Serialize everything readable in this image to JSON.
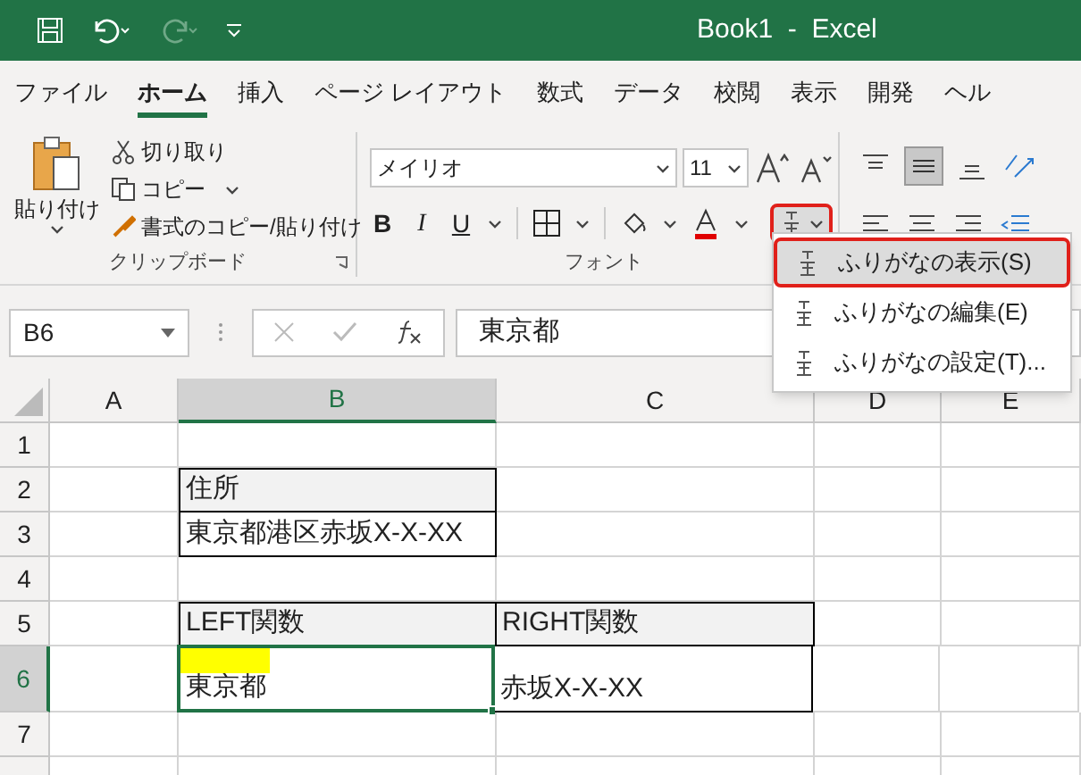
{
  "title_bar": {
    "title": "Book1  -  Excel"
  },
  "menu_tabs": [
    {
      "label": "ファイル",
      "selected": false
    },
    {
      "label": "ホーム",
      "selected": true
    },
    {
      "label": "挿入",
      "selected": false
    },
    {
      "label": "ページ レイアウト",
      "selected": false
    },
    {
      "label": "数式",
      "selected": false
    },
    {
      "label": "データ",
      "selected": false
    },
    {
      "label": "校閲",
      "selected": false
    },
    {
      "label": "表示",
      "selected": false
    },
    {
      "label": "開発",
      "selected": false
    },
    {
      "label": "ヘル",
      "selected": false
    }
  ],
  "clipboard": {
    "paste": "貼り付け",
    "cut": "切り取り",
    "copy": "コピー",
    "format_painter": "書式のコピー/貼り付け",
    "label": "クリップボード"
  },
  "font": {
    "name": "メイリオ",
    "size": "11",
    "bold": "B",
    "italic": "I",
    "underline": "U",
    "label": "フォント"
  },
  "furigana_menu": {
    "items": [
      {
        "label": "ふりがなの表示(S)",
        "selected": true
      },
      {
        "label": "ふりがなの編集(E)",
        "selected": false
      },
      {
        "label": "ふりがなの設定(T)...",
        "selected": false
      }
    ]
  },
  "formula_bar": {
    "name_box": "B6",
    "value": "東京都"
  },
  "columns": [
    {
      "label": "A",
      "selected": false
    },
    {
      "label": "B",
      "selected": true
    },
    {
      "label": "C",
      "selected": false
    },
    {
      "label": "D",
      "selected": false
    },
    {
      "label": "E",
      "selected": false
    }
  ],
  "rows": [
    {
      "number": "1",
      "selected": false,
      "cells": [
        {
          "kind": "plain"
        },
        {
          "kind": "plain"
        },
        {
          "kind": "plain"
        },
        {
          "kind": "plain"
        },
        {
          "kind": "plain"
        }
      ]
    },
    {
      "number": "2",
      "selected": false,
      "cells": [
        {
          "kind": "plain"
        },
        {
          "kind": "header",
          "text": "住所"
        },
        {
          "kind": "plain"
        },
        {
          "kind": "plain"
        },
        {
          "kind": "plain"
        }
      ]
    },
    {
      "number": "3",
      "selected": false,
      "cells": [
        {
          "kind": "plain"
        },
        {
          "kind": "value",
          "text": "東京都港区赤坂X-X-XX"
        },
        {
          "kind": "plain"
        },
        {
          "kind": "plain"
        },
        {
          "kind": "plain"
        }
      ]
    },
    {
      "number": "4",
      "selected": false,
      "cells": [
        {
          "kind": "plain"
        },
        {
          "kind": "plain"
        },
        {
          "kind": "plain"
        },
        {
          "kind": "plain"
        },
        {
          "kind": "plain"
        }
      ]
    },
    {
      "number": "5",
      "selected": false,
      "cells": [
        {
          "kind": "plain"
        },
        {
          "kind": "header",
          "text": "LEFT関数"
        },
        {
          "kind": "header",
          "text": "RIGHT関数"
        },
        {
          "kind": "plain"
        },
        {
          "kind": "plain"
        }
      ]
    },
    {
      "number": "6",
      "selected": true,
      "cells": [
        {
          "kind": "plain"
        },
        {
          "kind": "value",
          "text": "東京都",
          "selected": true,
          "furigana_marker": true
        },
        {
          "kind": "value",
          "text": "赤坂X-X-XX"
        },
        {
          "kind": "plain"
        },
        {
          "kind": "plain"
        }
      ]
    },
    {
      "number": "7",
      "selected": false,
      "cells": [
        {
          "kind": "plain"
        },
        {
          "kind": "plain"
        },
        {
          "kind": "plain"
        },
        {
          "kind": "plain"
        },
        {
          "kind": "plain"
        }
      ]
    }
  ]
}
